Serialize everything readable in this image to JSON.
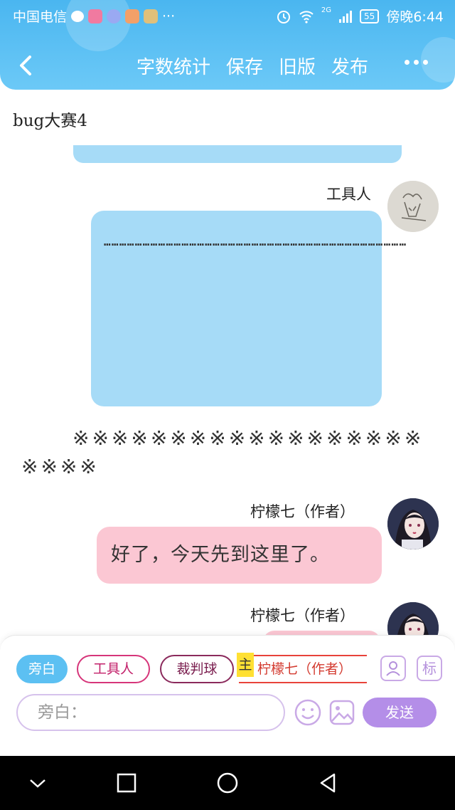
{
  "status_bar": {
    "carrier": "中国电信",
    "network": "2G",
    "battery": "55",
    "time": "傍晚6:44"
  },
  "toolbar": {
    "actions": [
      "字数统计",
      "保存",
      "旧版",
      "发布"
    ]
  },
  "document": {
    "title": "bug大赛4"
  },
  "messages": [
    {
      "speaker": "工具人",
      "text": "………………………………………………………………………………………………………"
    },
    {
      "type": "narration",
      "text": "※※※※※※※※※※※※※※※※※※※※※※"
    },
    {
      "speaker": "柠檬七（作者）",
      "text": "好了，今天先到这里了。"
    },
    {
      "speaker": "柠檬七（作者）",
      "text": ""
    }
  ],
  "role_chips": [
    {
      "label": "旁白"
    },
    {
      "label": "工具人"
    },
    {
      "label": "裁判球"
    },
    {
      "label": "柠檬七（作者）"
    }
  ],
  "main_badge": "主",
  "tag_button": "标",
  "input": {
    "placeholder": "旁白："
  },
  "send_label": "发送",
  "colors": {
    "header": "#4ab6f0",
    "blue_bubble": "#a6dbf7",
    "pink_bubble": "#fbc7d3",
    "send": "#b48ee8"
  }
}
